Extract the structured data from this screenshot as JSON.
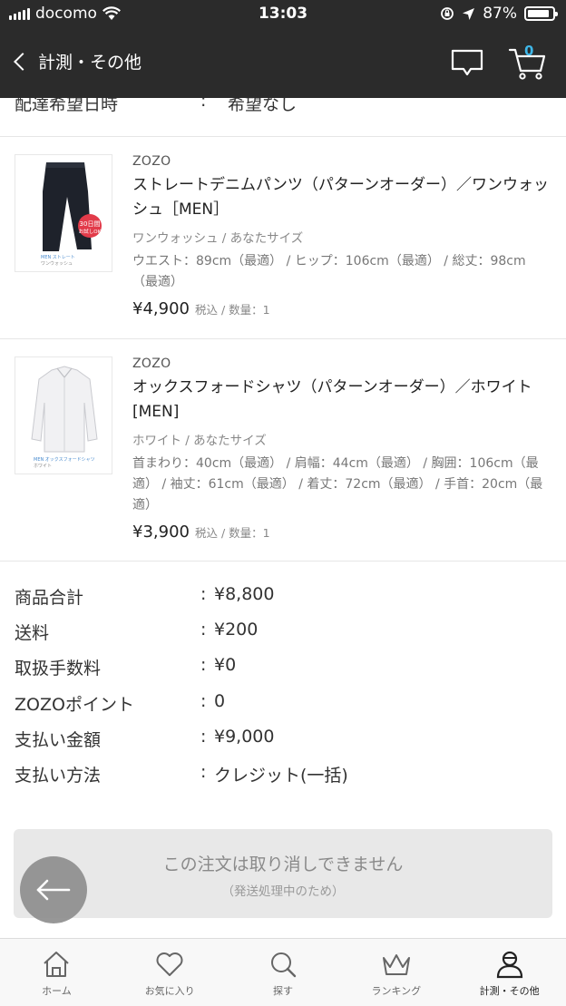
{
  "status_bar": {
    "carrier": "docomo",
    "time": "13:03",
    "battery": "87%",
    "battery_level": 0.87
  },
  "nav": {
    "back_label": "計測・その他",
    "cart_count": "0",
    "icons": [
      "back-chevron",
      "message-icon",
      "cart-icon"
    ]
  },
  "delivery_row": {
    "label": "配達希望日時",
    "sep": ":",
    "value": "希望なし"
  },
  "items": [
    {
      "brand": "ZOZO",
      "title": "ストレートデニムパンツ（パターンオーダー）／ワンウォッシュ［MEN］",
      "variant": "ワンウォッシュ / あなたサイズ",
      "spec": "ウエスト：89cm（最適） / ヒップ：106cm（最適） / 総丈：98cm（最適）",
      "price": "¥4,900",
      "qty": "税込 / 数量：1"
    },
    {
      "brand": "ZOZO",
      "title": "オックスフォードシャツ（パターンオーダー）／ホワイト [MEN]",
      "variant": "ホワイト / あなたサイズ",
      "spec": "首まわり：40cm（最適） / 肩幅：44cm（最適） / 胸囲：106cm（最適） / 袖丈：61cm（最適） / 着丈：72cm（最適） / 手首：20cm（最適）",
      "price": "¥3,900",
      "qty": "税込 / 数量：1"
    }
  ],
  "summary": [
    {
      "label": "商品合計",
      "sep": ":",
      "value": "¥8,800"
    },
    {
      "label": "送料",
      "sep": ":",
      "value": "¥200"
    },
    {
      "label": "取扱手数料",
      "sep": ":",
      "value": "¥0"
    },
    {
      "label": "ZOZOポイント",
      "sep": ":",
      "value": "0"
    },
    {
      "label": "支払い金額",
      "sep": ":",
      "value": "¥9,000"
    },
    {
      "label": "支払い方法",
      "sep": ":",
      "value": "クレジット(一括)"
    }
  ],
  "cancel": {
    "main": "この注文は取り消しできません",
    "sub": "（発送処理中のため）"
  },
  "tabs": [
    {
      "label": "ホーム",
      "icon": "home-icon"
    },
    {
      "label": "お気に入り",
      "icon": "heart-icon"
    },
    {
      "label": "探す",
      "icon": "search-icon"
    },
    {
      "label": "ランキング",
      "icon": "crown-icon"
    },
    {
      "label": "計測・その他",
      "icon": "person-icon",
      "active": true
    }
  ],
  "colors": {
    "header_bg": "#2b2b2b",
    "cart_badge": "#3fb7e8",
    "cancel_bg": "#e8e8e8"
  }
}
